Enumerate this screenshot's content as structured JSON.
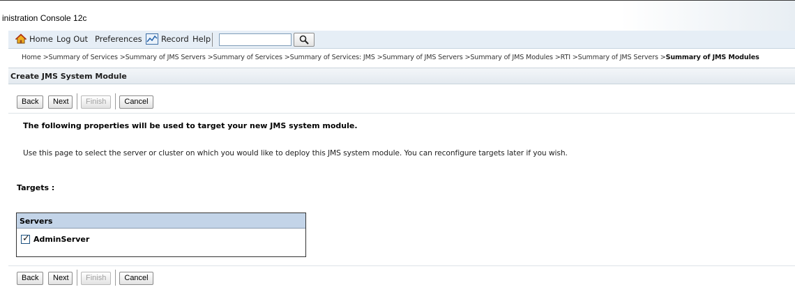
{
  "window": {
    "title": "inistration Console 12c"
  },
  "toolbar": {
    "home": "Home",
    "logout": "Log Out",
    "preferences": "Preferences",
    "record": "Record",
    "help": "Help",
    "search_value": ""
  },
  "breadcrumb": {
    "trail": "Home >Summary of Services >Summary of JMS Servers >Summary of Services >Summary of Services: JMS >Summary of JMS Servers >Summary of JMS Modules >RTI >Summary of JMS Servers >",
    "current": "Summary of JMS Modules"
  },
  "panel": {
    "title": "Create JMS System Module"
  },
  "buttons": {
    "back": "Back",
    "next": "Next",
    "finish": "Finish",
    "cancel": "Cancel"
  },
  "content": {
    "heading": "The following properties will be used to target your new JMS system module.",
    "description": "Use this page to select the server or cluster on which you would like to deploy this JMS system module. You can reconfigure targets later if you wish.",
    "targets_label": "Targets :"
  },
  "servers": {
    "header": "Servers",
    "items": [
      {
        "name": "AdminServer",
        "checked": true
      }
    ]
  },
  "colors": {
    "toolbar_bg": "#e6eef6",
    "table_header_bg": "#c3d4e8"
  }
}
